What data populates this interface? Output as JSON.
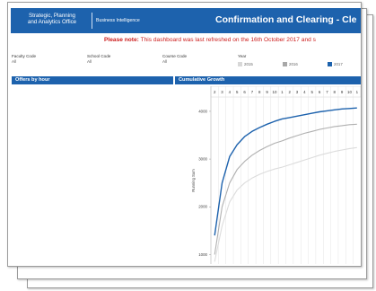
{
  "header": {
    "org_line1": "Strategic, Planning",
    "org_line2": "and Analytics Office",
    "subtitle": "Business Intelligence",
    "title": "Confirmation and Clearing - Cle"
  },
  "notice": {
    "prefix": "Please note:",
    "text": " This dashboard was last refreshed on the 16th October 2017 and s"
  },
  "filters": [
    {
      "label": "Faculty Code",
      "value": "All"
    },
    {
      "label": "School Code",
      "value": "All"
    },
    {
      "label": "Course Code",
      "value": "All"
    }
  ],
  "year_filter": {
    "label": "Year",
    "options": [
      {
        "label": "2015",
        "color": "#d8d8d8"
      },
      {
        "label": "2016",
        "color": "#a8a8a8"
      },
      {
        "label": "2017",
        "color": "#1d62ad"
      }
    ]
  },
  "panels": {
    "left_title": "Offers by hour",
    "right_title": "Cumulative Growth"
  },
  "chart_data": {
    "type": "line",
    "title": "Cumulative Growth",
    "xlabel": "",
    "ylabel": "Running Sum",
    "x_ticks": [
      "2",
      "3",
      "4",
      "5",
      "6",
      "7",
      "8",
      "9",
      "10",
      "1",
      "2",
      "3",
      "4",
      "5",
      "6",
      "7",
      "8",
      "9",
      "10",
      "1"
    ],
    "y_ticks": [
      "1000",
      "2000",
      "3000",
      "4000"
    ],
    "ylim": [
      800,
      4300
    ],
    "series": [
      {
        "name": "2015",
        "color": "#dcdcdc",
        "values": [
          850,
          1600,
          2100,
          2350,
          2500,
          2600,
          2680,
          2740,
          2790,
          2830,
          2880,
          2930,
          2980,
          3030,
          3080,
          3120,
          3160,
          3190,
          3220,
          3240
        ]
      },
      {
        "name": "2016",
        "color": "#b0b0b0",
        "values": [
          1000,
          2000,
          2500,
          2780,
          2950,
          3080,
          3180,
          3260,
          3330,
          3380,
          3440,
          3490,
          3540,
          3580,
          3620,
          3650,
          3680,
          3700,
          3720,
          3730
        ]
      },
      {
        "name": "2017",
        "color": "#1d62ad",
        "values": [
          1400,
          2500,
          3050,
          3300,
          3470,
          3580,
          3660,
          3730,
          3790,
          3840,
          3870,
          3900,
          3930,
          3960,
          3990,
          4010,
          4030,
          4050,
          4060,
          4070
        ]
      }
    ]
  }
}
